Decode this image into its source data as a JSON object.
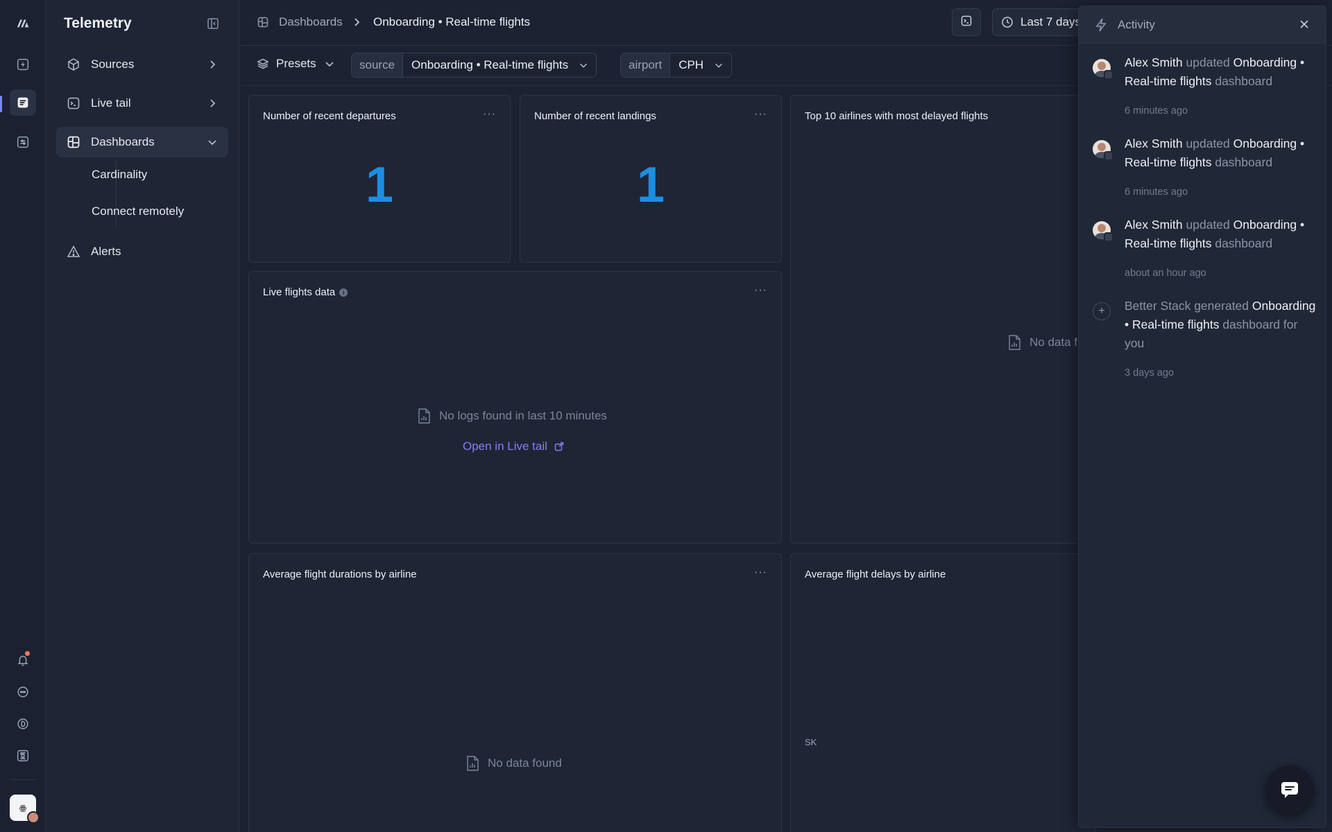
{
  "sidebar": {
    "title": "Telemetry",
    "items": [
      {
        "label": "Sources",
        "icon": "cube-icon"
      },
      {
        "label": "Live tail",
        "icon": "terminal-icon"
      },
      {
        "label": "Dashboards",
        "icon": "dashboard-grid-icon"
      },
      {
        "label": "Alerts",
        "icon": "warning-icon"
      }
    ],
    "subitems": [
      {
        "label": "Cardinality"
      },
      {
        "label": "Connect remotely"
      }
    ]
  },
  "breadcrumb": {
    "parent": "Dashboards",
    "current": "Onboarding • Real-time flights"
  },
  "topbar": {
    "time_range": "Last 7 days"
  },
  "filters": {
    "presets_label": "Presets",
    "source_key": "source",
    "source_value": "Onboarding • Real-time flights",
    "airport_key": "airport",
    "airport_value": "CPH"
  },
  "panels": {
    "departures": {
      "title": "Number of recent departures",
      "value": "1"
    },
    "landings": {
      "title": "Number of recent landings",
      "value": "1"
    },
    "delayed": {
      "title": "Top 10 airlines with most delayed flights",
      "empty": "No data f"
    },
    "live": {
      "title": "Live flights data",
      "info": "i",
      "empty": "No logs found in last 10 minutes",
      "link": "Open in Live tail"
    },
    "durations": {
      "title": "Average flight durations by airline",
      "empty": "No data found"
    },
    "delays": {
      "title": "Average flight delays by airline",
      "axis_label": "SK"
    },
    "menu_label": "···"
  },
  "activity": {
    "title": "Activity",
    "items": [
      {
        "actor": "Alex Smith",
        "verb": "updated",
        "object": "Onboarding • Real-time flights",
        "suffix": "dashboard",
        "time": "6 minutes ago"
      },
      {
        "actor": "Alex Smith",
        "verb": "updated",
        "object": "Onboarding • Real-time flights",
        "suffix": "dashboard",
        "time": "6 minutes ago"
      },
      {
        "actor": "Alex Smith",
        "verb": "updated",
        "object": "Onboarding • Real-time flights",
        "suffix": "dashboard",
        "time": "about an hour ago"
      },
      {
        "actor": "Better Stack",
        "verb": "generated",
        "object": "Onboarding • Real-time flights",
        "suffix": "dashboard for you",
        "time": "3 days ago"
      }
    ]
  },
  "colors": {
    "accent": "#7c83ff",
    "metric_blue": "#1c8fe0",
    "link_purple": "#8b7cf6",
    "notification": "#f07b5a"
  }
}
